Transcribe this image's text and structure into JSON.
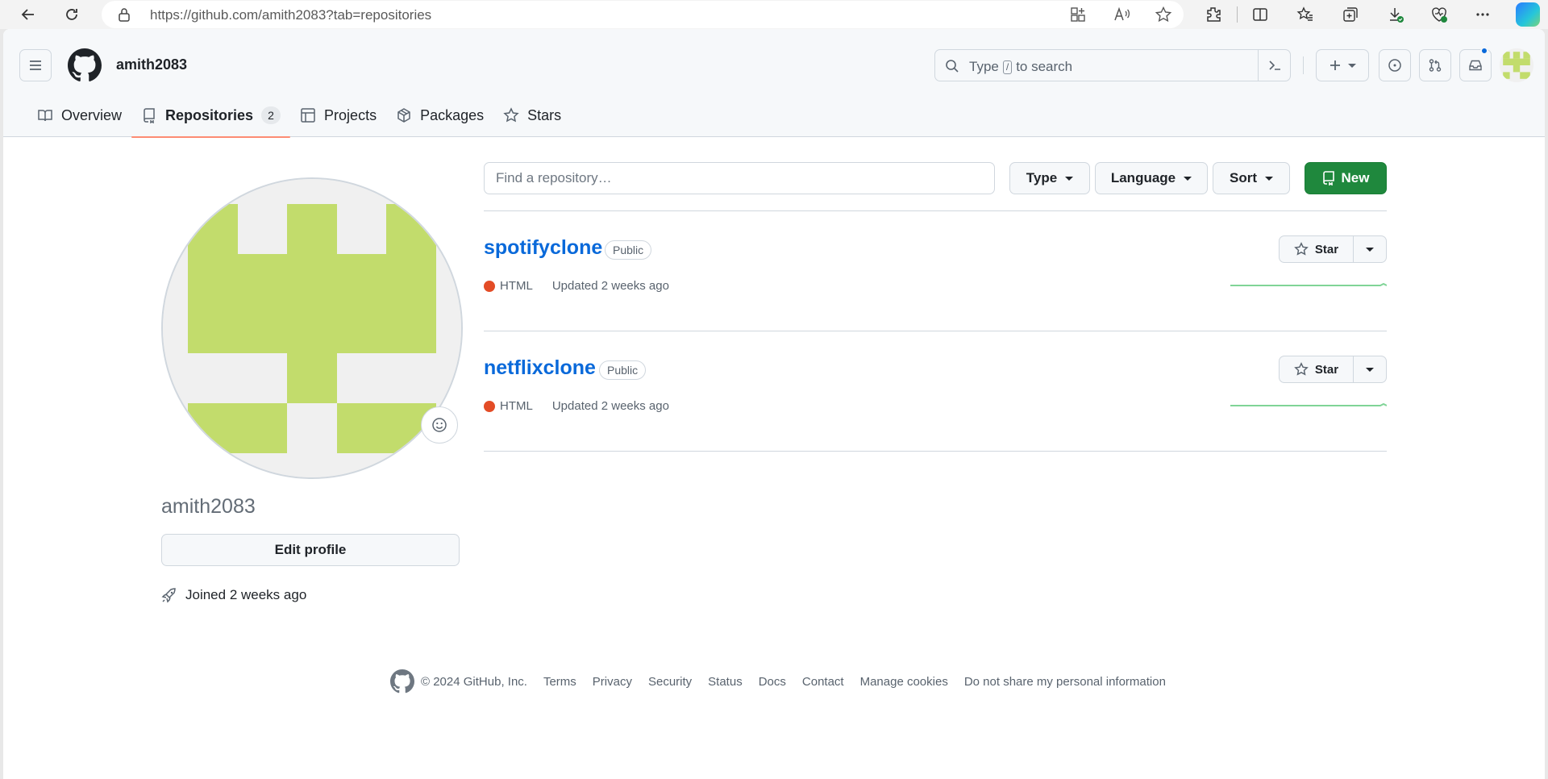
{
  "browser": {
    "url": "https://github.com/amith2083?tab=repositories",
    "icons": [
      "back-icon",
      "refresh-icon",
      "lock-icon",
      "apps-icon",
      "read-aloud-icon",
      "favorite-star-icon",
      "extensions-icon",
      "split-screen-icon",
      "favorites-icon",
      "collections-icon",
      "downloads-icon",
      "browser-essentials-icon",
      "more-icon",
      "copilot-icon"
    ]
  },
  "header": {
    "username": "amith2083",
    "search_placeholder_pre": "Type",
    "search_key": "/",
    "search_placeholder_post": "to search"
  },
  "tabs": [
    {
      "label": "Overview"
    },
    {
      "label": "Repositories",
      "count": "2",
      "selected": true
    },
    {
      "label": "Projects"
    },
    {
      "label": "Packages"
    },
    {
      "label": "Stars"
    }
  ],
  "profile": {
    "login": "amith2083",
    "edit_label": "Edit profile",
    "joined": "Joined 2 weeks ago"
  },
  "repo_filters": {
    "search_placeholder": "Find a repository…",
    "type_label": "Type",
    "language_label": "Language",
    "sort_label": "Sort",
    "new_label": "New"
  },
  "repositories": [
    {
      "name": "spotifyclone",
      "visibility": "Public",
      "language": "HTML",
      "language_color": "#e34c26",
      "updated": "Updated 2 weeks ago",
      "star_label": "Star"
    },
    {
      "name": "netflixclone",
      "visibility": "Public",
      "language": "HTML",
      "language_color": "#e34c26",
      "updated": "Updated 2 weeks ago",
      "star_label": "Star"
    }
  ],
  "footer": {
    "copyright": "© 2024 GitHub, Inc.",
    "links": [
      "Terms",
      "Privacy",
      "Security",
      "Status",
      "Docs",
      "Contact",
      "Manage cookies",
      "Do not share my personal information"
    ]
  },
  "colors": {
    "accent": "#0969da",
    "primary_button": "#1f883d",
    "avatar_identicon": "#c2dc6c",
    "selected_tab_underline": "#fd8c73"
  }
}
